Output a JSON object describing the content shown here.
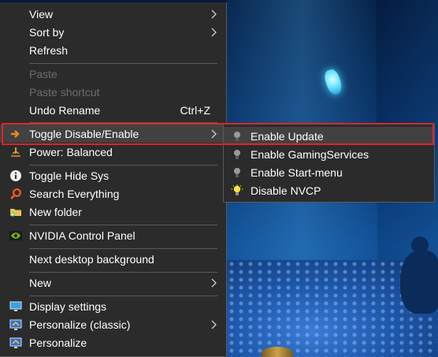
{
  "context_menu": {
    "items": [
      {
        "label": "View",
        "submenu": true
      },
      {
        "label": "Sort by",
        "submenu": true
      },
      {
        "label": "Refresh"
      },
      {
        "label": "Paste",
        "disabled": true
      },
      {
        "label": "Paste shortcut",
        "disabled": true
      },
      {
        "label": "Undo Rename",
        "accelerator": "Ctrl+Z"
      },
      {
        "label": "Toggle Disable/Enable",
        "icon": "orange-arrow-icon",
        "submenu": true,
        "highlighted": true
      },
      {
        "label": "Power: Balanced",
        "icon": "power-plan-icon"
      },
      {
        "label": "Toggle Hide Sys",
        "icon": "info-icon"
      },
      {
        "label": "Search Everything",
        "icon": "magnifier-icon"
      },
      {
        "label": "New folder",
        "icon": "folder-icon"
      },
      {
        "label": "NVIDIA Control Panel",
        "icon": "nvidia-icon"
      },
      {
        "label": "Next desktop background"
      },
      {
        "label": "New",
        "submenu": true
      },
      {
        "label": "Display settings",
        "icon": "display-icon"
      },
      {
        "label": "Personalize (classic)",
        "icon": "personalize-icon",
        "submenu": true
      },
      {
        "label": "Personalize",
        "icon": "personalize-icon"
      }
    ]
  },
  "submenu": {
    "items": [
      {
        "label": "Enable Update",
        "icon": "bulb-off-icon",
        "highlighted": true
      },
      {
        "label": "Enable GamingServices",
        "icon": "bulb-off-icon"
      },
      {
        "label": "Enable Start-menu",
        "icon": "bulb-off-icon"
      },
      {
        "label": "Disable NVCP",
        "icon": "bulb-on-icon"
      }
    ]
  },
  "colors": {
    "menu_bg": "#2b2b2b",
    "highlight": "#414141",
    "focus_outline": "#e0242a",
    "disabled_text": "#6d6d6d"
  }
}
